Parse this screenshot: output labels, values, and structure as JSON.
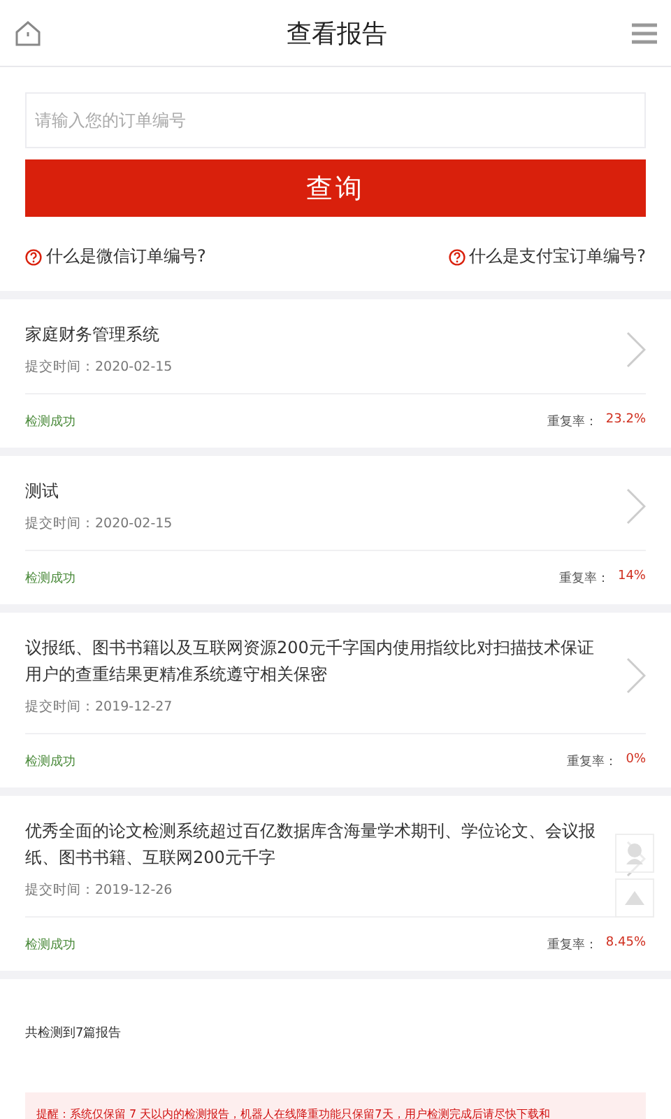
{
  "header": {
    "title": "查看报告"
  },
  "search": {
    "placeholder": "请输入您的订单编号",
    "button": "查询"
  },
  "help_links": [
    "什么是微信订单编号?",
    "什么是支付宝订单编号?"
  ],
  "reports": [
    {
      "title": "家庭财务管理系统",
      "date": "提交时间：2020-02-15",
      "status": "检测成功",
      "rate_label": "重复率：",
      "rate": "23.2%"
    },
    {
      "title": "测试",
      "date": "提交时间：2020-02-15",
      "status": "检测成功",
      "rate_label": "重复率：",
      "rate": "14%"
    },
    {
      "title": "议报纸、图书书籍以及互联网资源200元千字国内使用指纹比对扫描技术保证用户的查重结果更精准系统遵守相关保密",
      "date": "提交时间：2019-12-27",
      "status": "检测成功",
      "rate_label": "重复率：",
      "rate": "0%"
    },
    {
      "title": "优秀全面的论文检测系统超过百亿数据库含海量学术期刊、学位论文、会议报纸、图书书籍、互联网200元千字",
      "date": "提交时间：2019-12-26",
      "status": "检测成功",
      "rate_label": "重复率：",
      "rate": "8.45%"
    }
  ],
  "summary": "共检测到7篇报告",
  "notice": "提醒：系统仅保留 7 天以内的检测报告，机器人在线降重功能只保留7天，用户检测完成后请尽快下载和"
}
